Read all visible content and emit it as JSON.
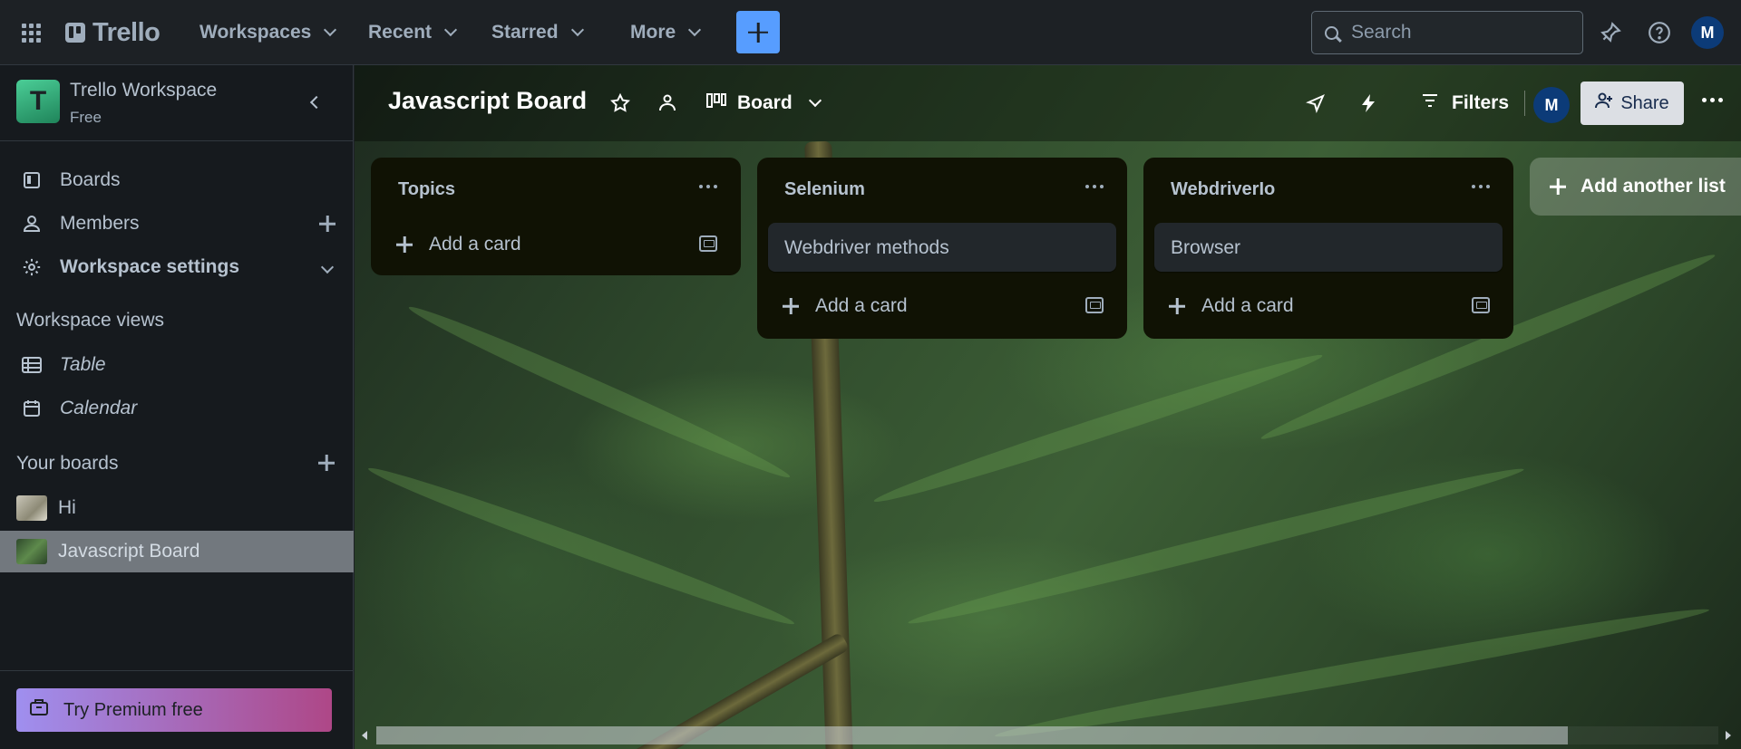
{
  "topnav": {
    "logo_text": "Trello",
    "menus": [
      {
        "label": "Workspaces"
      },
      {
        "label": "Recent"
      },
      {
        "label": "Starred"
      },
      {
        "label": "More"
      }
    ],
    "search_placeholder": "Search",
    "avatar_initial": "M",
    "create_color": "#579dff"
  },
  "sidebar": {
    "workspace_initial": "T",
    "workspace_name": "Trello Workspace",
    "workspace_plan": "Free",
    "items": [
      {
        "label": "Boards",
        "icon": "board-icon"
      },
      {
        "label": "Members",
        "icon": "person-icon"
      },
      {
        "label": "Workspace settings",
        "icon": "gear-icon"
      }
    ],
    "views_heading": "Workspace views",
    "views": [
      {
        "label": "Table",
        "icon": "table-icon"
      },
      {
        "label": "Calendar",
        "icon": "calendar-icon"
      }
    ],
    "boards_heading": "Your boards",
    "boards": [
      {
        "label": "Hi"
      },
      {
        "label": "Javascript Board",
        "active": true
      }
    ],
    "premium_label": "Try Premium free"
  },
  "board": {
    "title": "Javascript Board",
    "view_label": "Board",
    "filters_label": "Filters",
    "member_initial": "M",
    "share_label": "Share",
    "lists": [
      {
        "title": "Topics",
        "cards": [],
        "add_card_label": "Add a card"
      },
      {
        "title": "Selenium",
        "cards": [
          "Webdriver methods"
        ],
        "add_card_label": "Add a card"
      },
      {
        "title": "WebdriverIo",
        "cards": [
          "Browser"
        ],
        "add_card_label": "Add a card"
      }
    ],
    "add_list_label": "Add another list"
  }
}
